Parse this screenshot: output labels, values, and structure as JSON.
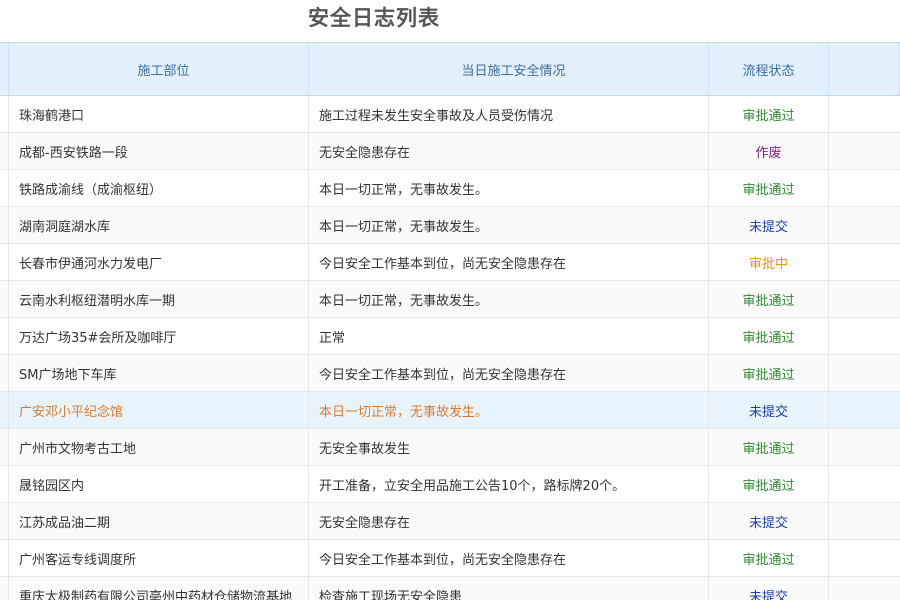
{
  "page": {
    "title": "安全日志列表"
  },
  "table": {
    "headers": [
      "施工部位",
      "当日施工安全情况",
      "流程状态"
    ],
    "status_colors": {
      "审批通过": "#2e8b2e",
      "作废": "#8b1a8b",
      "未提交": "#1a3fb0",
      "审批中": "#e69500"
    },
    "rows": [
      {
        "location": "珠海鹤港口",
        "situation": "施工过程未发生安全事故及人员受伤情况",
        "status": "审批通过"
      },
      {
        "location": "成都-西安铁路一段",
        "situation": "无安全隐患存在",
        "status": "作废"
      },
      {
        "location": "铁路成渝线（成渝枢纽）",
        "situation": "本日一切正常，无事故发生。",
        "status": "审批通过"
      },
      {
        "location": "湖南洞庭湖水库",
        "situation": "本日一切正常，无事故发生。",
        "status": "未提交"
      },
      {
        "location": "长春市伊通河水力发电厂",
        "situation": "今日安全工作基本到位，尚无安全隐患存在",
        "status": "审批中"
      },
      {
        "location": "云南水利枢纽潜明水库一期",
        "situation": "本日一切正常，无事故发生。",
        "status": "审批通过"
      },
      {
        "location": "万达广场35#会所及咖啡厅",
        "situation": "正常",
        "status": "审批通过"
      },
      {
        "location": "SM广场地下车库",
        "situation": "今日安全工作基本到位，尚无安全隐患存在",
        "status": "审批通过"
      },
      {
        "location": "广安邓小平纪念馆",
        "situation": "本日一切正常，无事故发生。",
        "status": "未提交"
      },
      {
        "location": "广州市文物考古工地",
        "situation": "无安全事故发生",
        "status": "审批通过"
      },
      {
        "location": "晟铭园区内",
        "situation": "开工准备，立安全用品施工公告10个，路标牌20个。",
        "status": "审批通过"
      },
      {
        "location": "江苏成品油二期",
        "situation": "无安全隐患存在",
        "status": "未提交"
      },
      {
        "location": "广州客运专线调度所",
        "situation": "今日安全工作基本到位，尚无安全隐患存在",
        "status": "审批通过"
      },
      {
        "location": "重庆太极制药有限公司亳州中药材仓储物流基地",
        "situation": "检查施工现场无安全隐患",
        "status": "未提交"
      }
    ]
  }
}
